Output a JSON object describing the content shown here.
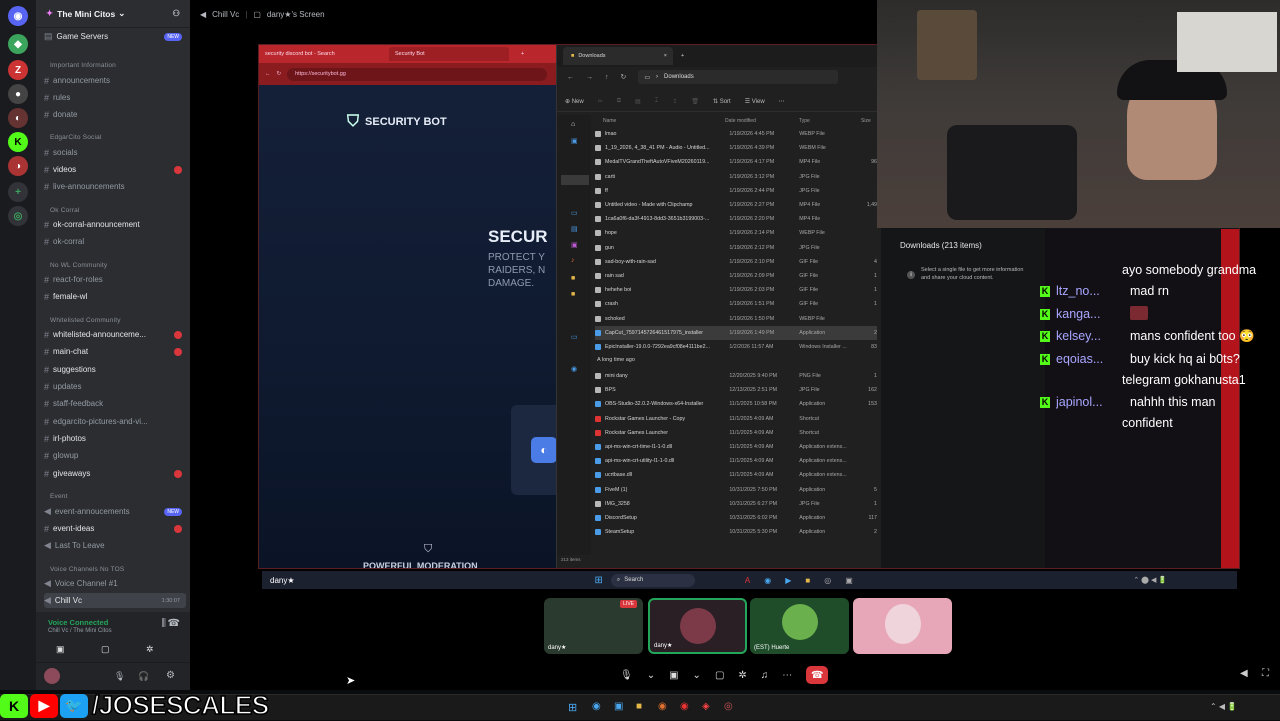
{
  "server": {
    "name": "The Mini Citos"
  },
  "channels": {
    "game_servers": "Game Servers",
    "game_servers_badge": "NEW",
    "cat_important": "Important Information",
    "announcements": "announcements",
    "rules": "rules",
    "donate": "donate",
    "cat_social": "EdgarCito Social",
    "socials": "socials",
    "videos": "videos",
    "live_announcements": "live-announcements",
    "cat_okcorral": "Ok Corral",
    "ok_corral_announcement": "ok-corral-announcement",
    "ok_corral": "ok-corral",
    "cat_nowl": "No WL Community",
    "react_for_roles": "react-for-roles",
    "female_wl": "female-wl",
    "cat_wl": "Whitelisted Community",
    "whitelisted_announce": "whitelisted-announceme...",
    "main_chat": "main-chat",
    "suggestions": "suggestions",
    "updates": "updates",
    "staff_feedback": "staff-feedback",
    "edgarcito_pictures": "edgarcito-pictures-and-vi...",
    "irl_photos": "irl-photos",
    "glowup": "glowup",
    "giveaways": "giveaways",
    "cat_event": "Event",
    "event_announcements": "event-annoucements",
    "event_announcements_badge": "NEW",
    "event_ideas": "event-ideas",
    "last_to_leave": "Last To Leave",
    "cat_voice": "Voice Channels No TOS",
    "voice_channel_1": "Voice Channel #1",
    "chill_vc": "Chill Vc",
    "chill_vc_time": "1:30:07"
  },
  "voice": {
    "status": "Voice Connected",
    "location": "Chill Vc / The Mini Citos"
  },
  "stage": {
    "channel": "Chill Vc",
    "screen_label": "dany★'s Screen"
  },
  "browser": {
    "tab1": "security discord bot - Search",
    "tab2": "Security Bot",
    "url": "https://securitybot.gg",
    "brand": "SECURITY BOT",
    "heading": "SECUR",
    "sub1": "PROTECT Y",
    "sub2": "RAIDERS, N",
    "sub3": "DAMAGE.",
    "footer_text": "POWERFUL MODERATION"
  },
  "explorer": {
    "tab": "Downloads",
    "breadcrumb": "Downloads",
    "new_label": "New",
    "sort_label": "Sort",
    "view_label": "View",
    "col_name": "Name",
    "col_date": "Date modified",
    "col_type": "Type",
    "col_size": "Size",
    "group_old": "A long time ago",
    "item_count": "213 items",
    "files": [
      {
        "name": "lmao",
        "date": "1/19/2026 4:45 PM",
        "type": "WEBP File",
        "size": ""
      },
      {
        "name": "1_19_2026, 4_38_41 PM - Audio - Untitled...",
        "date": "1/19/2026 4:39 PM",
        "type": "WEBM File",
        "size": ""
      },
      {
        "name": "MedalTVGrandTheftAutoVFiveM20260119...",
        "date": "1/19/2026 4:17 PM",
        "type": "MP4 File",
        "size": "96"
      },
      {
        "name": "carti",
        "date": "1/19/2026 3:12 PM",
        "type": "JPG File",
        "size": ""
      },
      {
        "name": "ff",
        "date": "1/19/2026 2:44 PM",
        "type": "JPG File",
        "size": ""
      },
      {
        "name": "Untitled video - Made with Clipchamp",
        "date": "1/19/2026 2:27 PM",
        "type": "MP4 File",
        "size": "1,49"
      },
      {
        "name": "1ca6a0f6-da3f-4913-8dd3-3651b3199003-...",
        "date": "1/19/2026 2:20 PM",
        "type": "MP4 File",
        "size": ""
      },
      {
        "name": "hope",
        "date": "1/19/2026 2:14 PM",
        "type": "WEBP File",
        "size": ""
      },
      {
        "name": "gun",
        "date": "1/19/2026 2:12 PM",
        "type": "JPG File",
        "size": ""
      },
      {
        "name": "sad-boy-with-rain-sad",
        "date": "1/19/2026 2:10 PM",
        "type": "GIF File",
        "size": "4"
      },
      {
        "name": "rain sad",
        "date": "1/19/2026 2:09 PM",
        "type": "GIF File",
        "size": "1"
      },
      {
        "name": "hehehe boi",
        "date": "1/19/2026 2:03 PM",
        "type": "GIF File",
        "size": "1"
      },
      {
        "name": "crash",
        "date": "1/19/2026 1:51 PM",
        "type": "GIF File",
        "size": "1"
      },
      {
        "name": "schoked",
        "date": "1/19/2026 1:50 PM",
        "type": "WEBP File",
        "size": ""
      },
      {
        "name": "CapCut_7597145726461517975_installer",
        "date": "1/19/2026 1:49 PM",
        "type": "Application",
        "size": "2"
      },
      {
        "name": "EpicInstaller-19.0.0-7292ea9cf08e4111be2...",
        "date": "1/2/2026 11:57 AM",
        "type": "Windows Installer ...",
        "size": "83"
      }
    ],
    "old_files": [
      {
        "name": "mini dany",
        "date": "12/20/2025 9:40 PM",
        "type": "PNG File",
        "size": "1"
      },
      {
        "name": "BPS",
        "date": "12/13/2025 2:51 PM",
        "type": "JPG File",
        "size": "162"
      },
      {
        "name": "OBS-Studio-32.0.2-Windows-x64-Installer",
        "date": "11/1/2025 10:58 PM",
        "type": "Application",
        "size": "153"
      },
      {
        "name": "Rockstar Games Launcher - Copy",
        "date": "11/1/2025 4:09 AM",
        "type": "Shortcut",
        "size": ""
      },
      {
        "name": "Rockstar Games Launcher",
        "date": "11/1/2025 4:09 AM",
        "type": "Shortcut",
        "size": ""
      },
      {
        "name": "api-ms-win-crt-time-l1-1-0.dll",
        "date": "11/1/2025 4:09 AM",
        "type": "Application extens...",
        "size": ""
      },
      {
        "name": "api-ms-win-crt-utility-l1-1-0.dll",
        "date": "11/1/2025 4:09 AM",
        "type": "Application extens...",
        "size": ""
      },
      {
        "name": "ucrtbase.dll",
        "date": "11/1/2025 4:09 AM",
        "type": "Application extens...",
        "size": ""
      },
      {
        "name": "FiveM (1)",
        "date": "10/31/2025 7:50 PM",
        "type": "Application",
        "size": "5"
      },
      {
        "name": "IMG_3258",
        "date": "10/31/2025 6:27 PM",
        "type": "JPG File",
        "size": "1"
      },
      {
        "name": "DiscordSetup",
        "date": "10/31/2025 6:02 PM",
        "type": "Application",
        "size": "117"
      },
      {
        "name": "SteamSetup",
        "date": "10/31/2025 5:30 PM",
        "type": "Application",
        "size": "2"
      }
    ]
  },
  "details": {
    "title": "Downloads (213 items)",
    "hint": "Select a single file to get more information and share your cloud content."
  },
  "chat": [
    {
      "user": "",
      "text": "ayo somebody grandma"
    },
    {
      "user": "ltz_no...",
      "text": "mad rn"
    },
    {
      "user": "kanga...",
      "text": ""
    },
    {
      "user": "kelsey...",
      "text": "mans confident too 😳"
    },
    {
      "user": "eqoias...",
      "text": "buy kick hq ai b0ts?"
    },
    {
      "user": "",
      "text": "telegram gokhanusta1"
    },
    {
      "user": "japinol...",
      "text": "nahhh this man"
    },
    {
      "user": "",
      "text": "confident"
    }
  ],
  "share_taskbar": {
    "search": "Search",
    "streamer_tag": "dany★"
  },
  "tiles": [
    {
      "label": "dany★",
      "live": "LIVE"
    },
    {
      "label": "dany★"
    },
    {
      "label": "(EST) Huerte"
    },
    {
      "label": ""
    }
  ],
  "bottom": {
    "handle": "/JOSESCALES"
  },
  "colors": {
    "accent_red": "#b9262b",
    "kick_green": "#53fc18",
    "discord_blurple": "#5865f2"
  }
}
